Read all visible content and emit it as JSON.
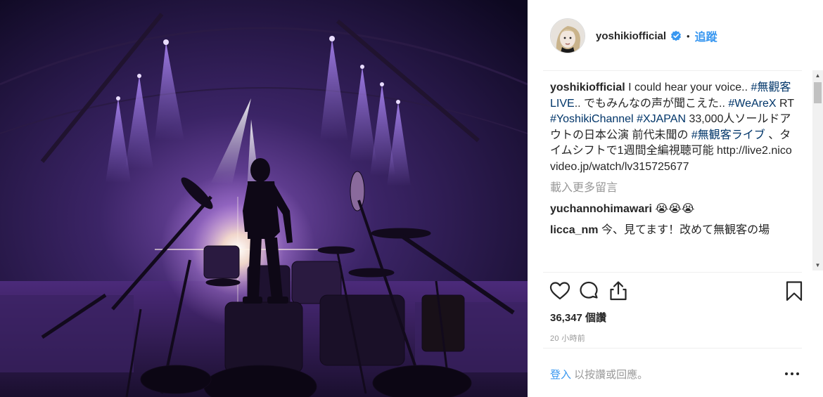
{
  "post": {
    "image_alt": "Drummer standing on a drum kit on an empty stadium stage under purple spotlights"
  },
  "header": {
    "username": "yoshikiofficial",
    "separator": "•",
    "follow_label": "追蹤"
  },
  "caption": {
    "username": "yoshikiofficial",
    "text1": "I could hear your voice.. ",
    "tag1": "#無觀客LIVE",
    "text2": ".. でもみんなの声が聞こえた.. ",
    "tag2": "#WeAreX",
    "text3": " RT ",
    "tag3": "#YoshikiChannel",
    "text4": " ",
    "tag4": "#XJAPAN",
    "text5": " 33,000人ソールドアウトの日本公演 前代未聞の ",
    "tag5": "#無観客ライブ",
    "text6": " 、タイムシフトで1週間全編視聴可能 http://live2.nicovideo.jp/watch/lv315725677"
  },
  "load_more": "載入更多留言",
  "comments": [
    {
      "user": "yuchannohimawari",
      "text": "😭😭😭"
    },
    {
      "user": "licca_nm",
      "text": "今、見てます！改めて無観客の場"
    }
  ],
  "likes": "36,347 個讚",
  "timestamp": "20 小時前",
  "footer": {
    "login": "登入",
    "rest": " 以按讚或回應。"
  },
  "icons": {
    "like": "heart-icon",
    "comment": "comment-bubble-icon",
    "share": "share-icon",
    "save": "bookmark-icon",
    "verified": "verified-badge-icon",
    "options": "more-options-icon"
  },
  "colors": {
    "link": "#3897f0",
    "hashtag": "#003569",
    "muted": "#999999",
    "stage_purple": "#6a3fb5"
  }
}
